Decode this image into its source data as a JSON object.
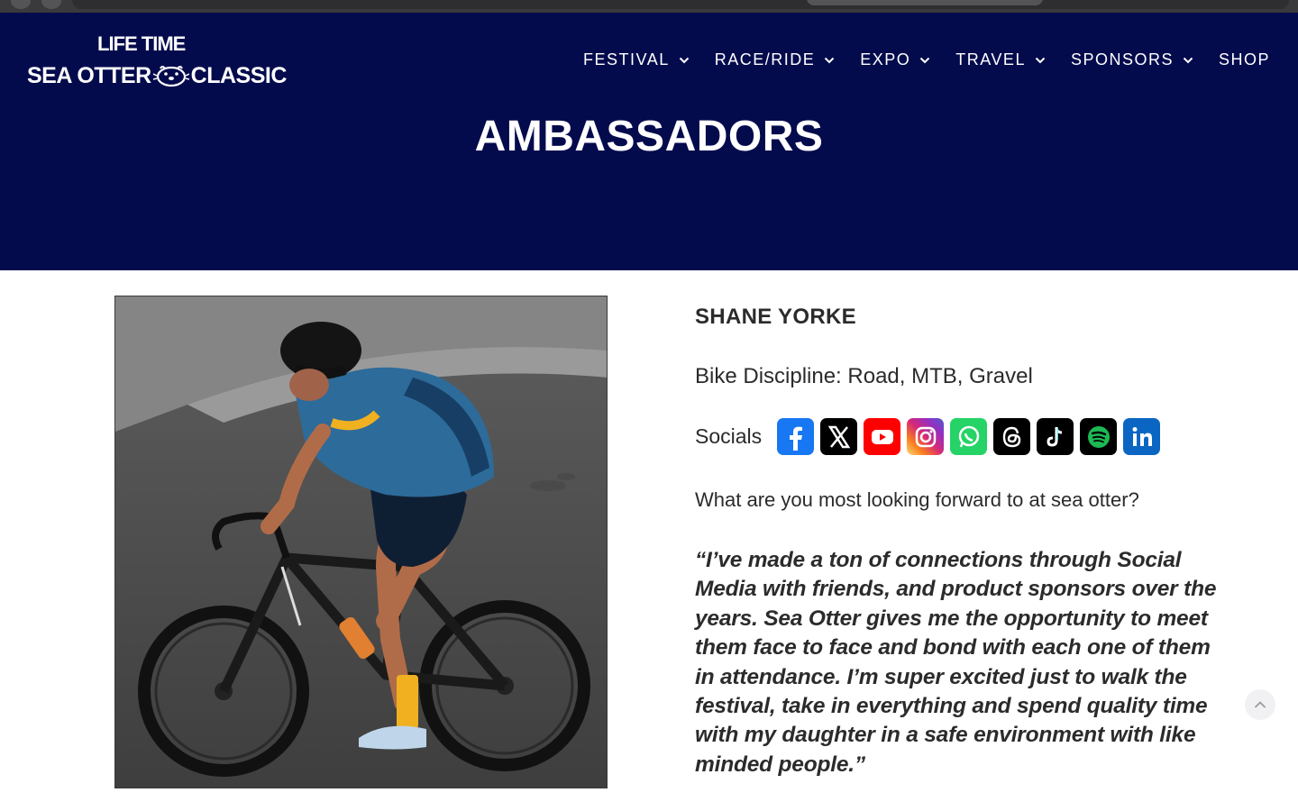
{
  "brand": {
    "top": "LIFE TIME",
    "bottom_left": "SEA OTTER",
    "bottom_right": "CLASSIC"
  },
  "nav": {
    "items": [
      {
        "label": "FESTIVAL",
        "has_dropdown": true
      },
      {
        "label": "RACE/RIDE",
        "has_dropdown": true
      },
      {
        "label": "EXPO",
        "has_dropdown": true
      },
      {
        "label": "TRAVEL",
        "has_dropdown": true
      },
      {
        "label": "SPONSORS",
        "has_dropdown": true
      },
      {
        "label": "SHOP",
        "has_dropdown": false
      }
    ]
  },
  "hero": {
    "title": "AMBASSADORS",
    "background": "#040b4d"
  },
  "ambassador": {
    "name": "SHANE YORKE",
    "discipline": "Bike Discipline: Road, MTB, Gravel",
    "socials_label": "Socials",
    "socials": [
      {
        "icon": "facebook-icon",
        "color": "#1877f2"
      },
      {
        "icon": "x-icon",
        "color": "#000000"
      },
      {
        "icon": "youtube-icon",
        "color": "#ff0000"
      },
      {
        "icon": "instagram-icon",
        "color": "#d62976"
      },
      {
        "icon": "whatsapp-icon",
        "color": "#25d366"
      },
      {
        "icon": "threads-icon",
        "color": "#000000"
      },
      {
        "icon": "tiktok-icon",
        "color": "#000000"
      },
      {
        "icon": "spotify-icon",
        "color": "#000000"
      },
      {
        "icon": "linkedin-icon",
        "color": "#0a66c2"
      }
    ],
    "question": "What are you most looking forward to at sea otter?",
    "quote": "“I’ve made a ton of connections through Social Media with friends, and product sponsors over the years. Sea Otter gives me the opportunity to meet them face to face and bond with each one of them in attendance. I’m super excited just to walk the festival, take in everything and spend quality time with my daughter in a safe environment with like minded people.”"
  }
}
